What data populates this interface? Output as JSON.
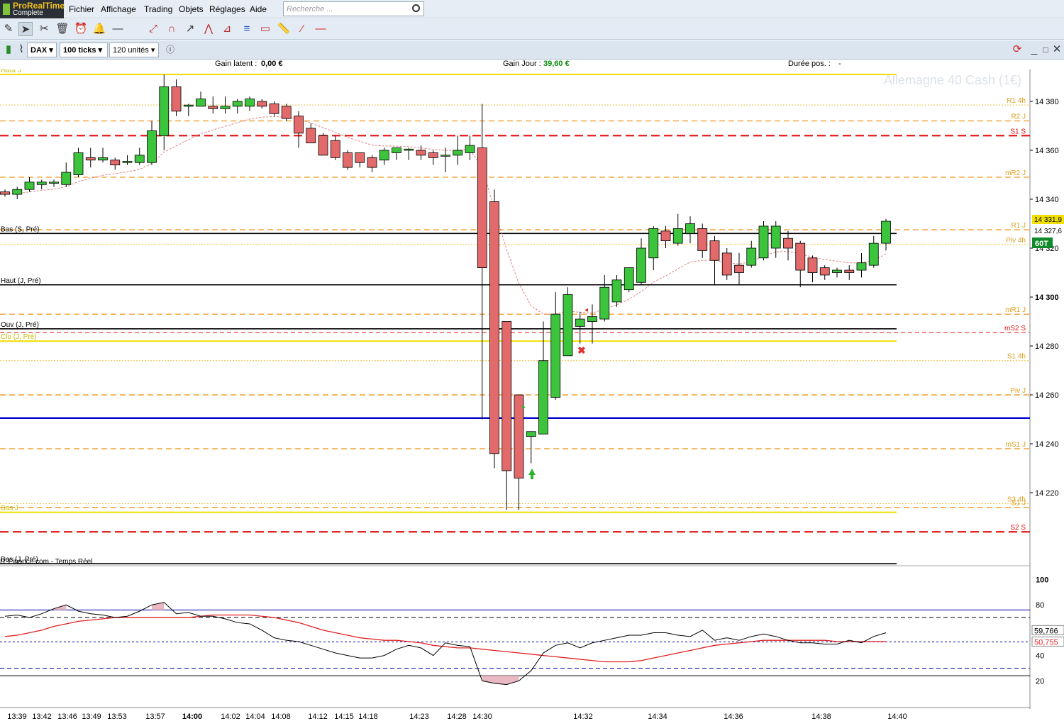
{
  "app": {
    "logo_line1": "ProRealTime",
    "logo_line2": "Complete"
  },
  "menu": [
    "Fichier",
    "Affichage",
    "Trading",
    "Objets",
    "Réglages",
    "Aide"
  ],
  "search": {
    "placeholder": "Recherche ..."
  },
  "toolbar2": {
    "symbol": "DAX",
    "period": "100 ticks",
    "units": "120 unités"
  },
  "info": {
    "gain_latent_label": "Gain latent :",
    "gain_latent_value": "0,00 €",
    "gain_jour_label": "Gain Jour :",
    "gain_jour_value": "39,60 €",
    "duree_label": "Durée pos. :",
    "duree_value": "-"
  },
  "chart": {
    "watermark": "Allemagne 40 Cash (1€)",
    "source": "IT-Finance.com - Temps Réel",
    "price_tag_current": "14 331,9",
    "price_tag_second": "14 327,6",
    "timer_tag": "60T",
    "colors": {
      "up": "#3cc43c",
      "down": "#e26a6a",
      "blue": "#0000d0",
      "red_dash": "#e01010",
      "orange": "#f0a030",
      "yellow": "#f0e000"
    }
  },
  "chart_data": [
    {
      "type": "candlestick",
      "title": "Allemagne 40 Cash (1€)",
      "ylim": [
        14200,
        14400
      ],
      "y_ticks": [
        "14 220",
        "14 240",
        "14 260",
        "14 280",
        "14 300",
        "14 320",
        "14 340",
        "14 360",
        "14 380"
      ],
      "x_ticks": [
        "13:39",
        "13:42",
        "13:46",
        "13:49",
        "13:53",
        "13:57",
        "14:00",
        "14:02",
        "14:04",
        "14:08",
        "14:12",
        "14:15",
        "14:18",
        "14:23",
        "14:28",
        "14:30",
        "14:32",
        "14:34",
        "14:36",
        "14:38",
        "14:40"
      ],
      "candles": [
        [
          14343.0,
          14344.0,
          14341.0,
          14342.0
        ],
        [
          14342.0,
          14345.0,
          14340.0,
          14344.0
        ],
        [
          14344.0,
          14349.0,
          14343.0,
          14347.0
        ],
        [
          14346.0,
          14348.0,
          14344.0,
          14347.0
        ],
        [
          14346.5,
          14348.0,
          14345.0,
          14347.0
        ],
        [
          14346.0,
          14355.0,
          14345.0,
          14351.0
        ],
        [
          14350.0,
          14361.0,
          14349.0,
          14359.0
        ],
        [
          14357.0,
          14361.0,
          14353.0,
          14356.0
        ],
        [
          14356.0,
          14361.0,
          14355.0,
          14357.0
        ],
        [
          14356.0,
          14357.0,
          14352.0,
          14354.0
        ],
        [
          14355.0,
          14358.0,
          14354.0,
          14355.5
        ],
        [
          14355.0,
          14361.0,
          14354.0,
          14358.0
        ],
        [
          14355.0,
          14372.0,
          14354.0,
          14368.0
        ],
        [
          14366.0,
          14391.0,
          14360.0,
          14386.0
        ],
        [
          14386.0,
          14389.0,
          14374.0,
          14376.0
        ],
        [
          14378.0,
          14379.0,
          14374.0,
          14378.5
        ],
        [
          14378.0,
          14384.0,
          14378.0,
          14381.0
        ],
        [
          14378.0,
          14382.0,
          14375.0,
          14377.0
        ],
        [
          14377.0,
          14382.0,
          14375.0,
          14378.0
        ],
        [
          14378.0,
          14381.0,
          14375.0,
          14380.0
        ],
        [
          14378.0,
          14382.0,
          14376.0,
          14381.0
        ],
        [
          14380.0,
          14381.0,
          14377.0,
          14378.0
        ],
        [
          14379.0,
          14380.0,
          14374.0,
          14375.0
        ],
        [
          14378.0,
          14379.0,
          14372.0,
          14373.0
        ],
        [
          14374.0,
          14376.0,
          14361.0,
          14367.0
        ],
        [
          14369.0,
          14371.0,
          14364.0,
          14363.0
        ],
        [
          14366.0,
          14367.0,
          14358.0,
          14358.0
        ],
        [
          14364.0,
          14366.0,
          14356.0,
          14357.0
        ],
        [
          14359.0,
          14360.0,
          14352.0,
          14353.0
        ],
        [
          14359.0,
          14359.0,
          14353.0,
          14355.0
        ],
        [
          14357.0,
          14358.0,
          14351.0,
          14353.0
        ],
        [
          14356.0,
          14361.0,
          14354.0,
          14360.0
        ],
        [
          14359.0,
          14361.0,
          14356.0,
          14361.0
        ],
        [
          14360.0,
          14361.0,
          14356.0,
          14360.5
        ],
        [
          14360.0,
          14362.0,
          14356.0,
          14358.0
        ],
        [
          14359.0,
          14360.0,
          14354.0,
          14357.0
        ],
        [
          14358.0,
          14361.0,
          14351.0,
          14358.0
        ],
        [
          14358.0,
          14366.0,
          14354.0,
          14360.0
        ],
        [
          14359.0,
          14366.0,
          14356.0,
          14362.0
        ],
        [
          14361.0,
          14379.0,
          14250.0,
          14312.0
        ],
        [
          14339.0,
          14344.0,
          14230.0,
          14236.0
        ],
        [
          14290.0,
          14290.0,
          14213.0,
          14229.0
        ],
        [
          14260.0,
          14260.0,
          14213.0,
          14226.0
        ],
        [
          14243.0,
          14245.0,
          14232.0,
          14245.0
        ],
        [
          14244.0,
          14290.0,
          14244.0,
          14274.0
        ],
        [
          14259.0,
          14302.0,
          14258.0,
          14293.0
        ],
        [
          14276.0,
          14304.0,
          14276.0,
          14301.0
        ],
        [
          14288.0,
          14294.0,
          14281.0,
          14291.0
        ],
        [
          14290.0,
          14297.0,
          14281.0,
          14292.0
        ],
        [
          14291.0,
          14309.0,
          14290.0,
          14304.0
        ],
        [
          14298.0,
          14309.0,
          14296.0,
          14307.0
        ],
        [
          14303.0,
          14312.0,
          14302.0,
          14312.0
        ],
        [
          14306.0,
          14324.0,
          14305.0,
          14320.0
        ],
        [
          14316.0,
          14329.0,
          14311.0,
          14328.0
        ],
        [
          14327.0,
          14329.0,
          14320.0,
          14323.0
        ],
        [
          14322.0,
          14334.0,
          14321.0,
          14328.0
        ],
        [
          14326.0,
          14333.0,
          14322.0,
          14330.0
        ],
        [
          14328.0,
          14330.0,
          14316.0,
          14319.0
        ],
        [
          14323.0,
          14325.0,
          14305.0,
          14315.0
        ],
        [
          14318.0,
          14320.0,
          14307.0,
          14309.0
        ],
        [
          14313.0,
          14318.0,
          14305.0,
          14310.0
        ],
        [
          14313.0,
          14323.0,
          14312.0,
          14320.0
        ],
        [
          14316.0,
          14331.0,
          14315.0,
          14329.0
        ],
        [
          14320.0,
          14331.0,
          14316.0,
          14329.0
        ],
        [
          14324.0,
          14327.0,
          14315.0,
          14320.0
        ],
        [
          14322.0,
          14323.0,
          14304.0,
          14311.0
        ],
        [
          14316.0,
          14317.0,
          14306.0,
          14310.0
        ],
        [
          14312.0,
          14313.0,
          14307.0,
          14309.0
        ],
        [
          14310.0,
          14312.0,
          14308.0,
          14311.0
        ],
        [
          14311.0,
          14313.0,
          14307.0,
          14310.0
        ],
        [
          14311.0,
          14318.0,
          14308.0,
          14314.0
        ],
        [
          14313.0,
          14325.0,
          14312.0,
          14322.0
        ],
        [
          14322.0,
          14332.0,
          14319.0,
          14331.0
        ]
      ],
      "levels": [
        {
          "name": "Haut J",
          "value": 14391.0,
          "style": "yellow"
        },
        {
          "name": "R1 4h",
          "value": 14378.5,
          "style": "orange-dot"
        },
        {
          "name": "R2 J",
          "value": 14372.0,
          "style": "orange"
        },
        {
          "name": "S1 S",
          "value": 14366.0,
          "style": "red"
        },
        {
          "name": "mR2 J",
          "value": 14349.0,
          "style": "orange"
        },
        {
          "name": "R1 J",
          "value": 14327.5,
          "style": "orange"
        },
        {
          "name": "Bas (S, Pré)",
          "value": 14326.0,
          "style": "black"
        },
        {
          "name": "Piv 4h",
          "value": 14321.5,
          "style": "orange-dot"
        },
        {
          "name": "Haut (J, Pré)",
          "value": 14305.0,
          "style": "black"
        },
        {
          "name": "mR1 J",
          "value": 14293.0,
          "style": "orange"
        },
        {
          "name": "Ouv (J, Pré)",
          "value": 14287.0,
          "style": "black"
        },
        {
          "name": "mS2 S",
          "value": 14285.5,
          "style": "red-thin"
        },
        {
          "name": "Clo (J, Pré)",
          "value": 14282.0,
          "style": "yellow"
        },
        {
          "name": "S1 4h",
          "value": 14274.0,
          "style": "orange-dot"
        },
        {
          "name": "Piv J",
          "value": 14260.0,
          "style": "orange"
        },
        {
          "name": "",
          "value": 14250.5,
          "style": "blue"
        },
        {
          "name": "mS1 J",
          "value": 14238.0,
          "style": "orange"
        },
        {
          "name": "S3 4h",
          "value": 14215.5,
          "style": "orange-dot"
        },
        {
          "name": "S1 J",
          "value": 14214.0,
          "style": "orange"
        },
        {
          "name": "Bas J",
          "value": 14212.0,
          "style": "yellow"
        },
        {
          "name": "S2 S",
          "value": 14204.0,
          "style": "red"
        },
        {
          "name": "Bas (J, Pré)",
          "value": 14191.0,
          "style": "black"
        }
      ]
    },
    {
      "type": "line",
      "title": "",
      "ylim": [
        0,
        100
      ],
      "y_ticks": [
        "100",
        "80",
        "60",
        "40",
        "20"
      ],
      "value_tags": [
        "59,766",
        "50,755"
      ],
      "series": [
        {
          "values": [
            71,
            72,
            70,
            73,
            77,
            80,
            75,
            73,
            72,
            70,
            71,
            75,
            80,
            82,
            73,
            74,
            71,
            71,
            69,
            66,
            65,
            60,
            54,
            52,
            51,
            48,
            45,
            42,
            40,
            38,
            38,
            40,
            45,
            48,
            46,
            40,
            50,
            48,
            47,
            20,
            18,
            17,
            20,
            28,
            42,
            48,
            50,
            46,
            50,
            52,
            54,
            56,
            56,
            58,
            58,
            56,
            55,
            60,
            52,
            54,
            52,
            55,
            57,
            55,
            52,
            50,
            50,
            49,
            49,
            52,
            50,
            55,
            58
          ]
        },
        {
          "values": [
            55,
            56,
            58,
            60,
            63,
            65,
            67,
            68,
            69,
            70,
            70,
            70,
            70,
            70,
            70,
            70,
            71,
            72,
            72,
            72,
            72,
            71,
            70,
            68,
            66,
            63,
            60,
            58,
            56,
            54,
            53,
            52,
            52,
            51,
            50,
            48,
            47,
            46,
            46,
            45,
            44,
            43,
            42,
            41,
            40,
            39,
            38,
            37,
            36,
            35,
            35,
            35,
            36,
            38,
            40,
            42,
            44,
            46,
            48,
            49,
            50,
            51,
            52,
            52,
            52,
            52,
            52,
            52,
            51,
            51,
            51,
            51,
            51
          ]
        }
      ]
    }
  ]
}
